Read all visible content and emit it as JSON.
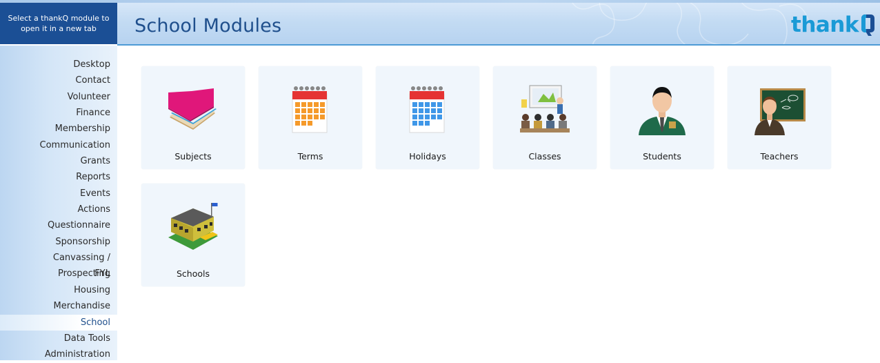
{
  "tip": "Select a thankQ module to open it in a new tab",
  "header": {
    "title": "School Modules",
    "logo_text": "thank"
  },
  "sidebar": {
    "items": [
      {
        "label": "Desktop"
      },
      {
        "label": "Contact"
      },
      {
        "label": "Volunteer"
      },
      {
        "label": "Finance"
      },
      {
        "label": "Membership"
      },
      {
        "label": "Communication"
      },
      {
        "label": "Grants"
      },
      {
        "label": "Reports"
      },
      {
        "label": "Events"
      },
      {
        "label": "Actions"
      },
      {
        "label": "Questionnaire"
      },
      {
        "label": "Sponsorship"
      },
      {
        "label": "Canvassing / Prospecting"
      },
      {
        "label": "FYL"
      },
      {
        "label": "Housing"
      },
      {
        "label": "Merchandise"
      },
      {
        "label": "School",
        "active": true
      },
      {
        "label": "Data Tools"
      },
      {
        "label": "Administration"
      }
    ]
  },
  "modules": [
    {
      "label": "Subjects",
      "icon": "books-icon"
    },
    {
      "label": "Terms",
      "icon": "calendar-orange-icon"
    },
    {
      "label": "Holidays",
      "icon": "calendar-blue-icon"
    },
    {
      "label": "Classes",
      "icon": "classroom-icon"
    },
    {
      "label": "Students",
      "icon": "student-icon"
    },
    {
      "label": "Teachers",
      "icon": "teacher-icon"
    },
    {
      "label": "Schools",
      "icon": "school-building-icon"
    }
  ],
  "colors": {
    "brand_blue": "#1b4f95",
    "title_blue": "#1f4f8c",
    "logo_cyan": "#1a9ad6",
    "tile_bg": "#f0f6fc"
  }
}
